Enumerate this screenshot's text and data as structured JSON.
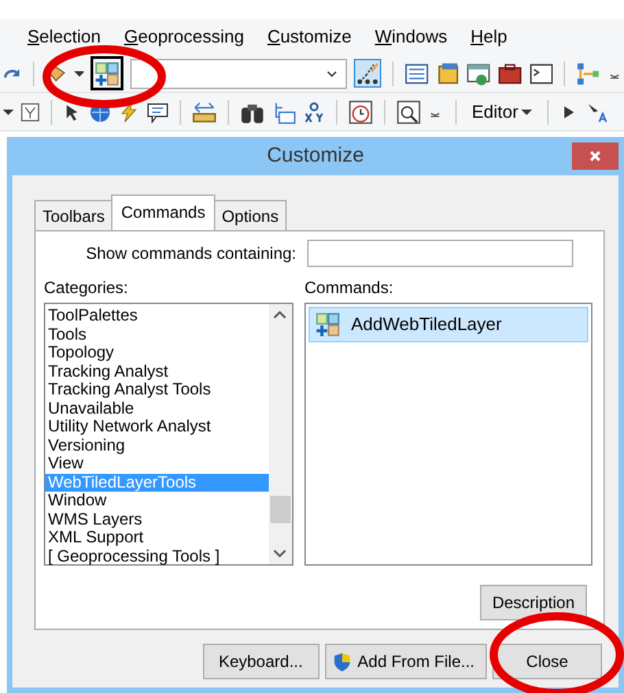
{
  "menu_bar": [
    {
      "label": "Selection"
    },
    {
      "label": "Geoprocessing"
    },
    {
      "label": "Customize"
    },
    {
      "label": "Windows"
    },
    {
      "label": "Help"
    }
  ],
  "toolbar": {
    "editor_menu": "Editor"
  },
  "dialog": {
    "title": "Customize",
    "tabs": [
      {
        "label": "Toolbars",
        "selected": false
      },
      {
        "label": "Commands",
        "selected": true
      },
      {
        "label": "Options",
        "selected": false
      }
    ],
    "search_label": "Show commands containing:",
    "categories_label": "Categories:",
    "categories": [
      {
        "label": "ToolPalettes",
        "selected": false
      },
      {
        "label": "Tools",
        "selected": false
      },
      {
        "label": "Topology",
        "selected": false
      },
      {
        "label": "Tracking Analyst",
        "selected": false
      },
      {
        "label": "Tracking Analyst Tools",
        "selected": false
      },
      {
        "label": "Unavailable",
        "selected": false
      },
      {
        "label": "Utility Network Analyst",
        "selected": false
      },
      {
        "label": "Versioning",
        "selected": false
      },
      {
        "label": "View",
        "selected": false
      },
      {
        "label": "WebTiledLayerTools",
        "selected": true
      },
      {
        "label": "Window",
        "selected": false
      },
      {
        "label": "WMS Layers",
        "selected": false
      },
      {
        "label": "XML Support",
        "selected": false
      },
      {
        "label": "[ Geoprocessing Tools ]",
        "selected": false
      }
    ],
    "commands_label": "Commands:",
    "commands": [
      {
        "label": "AddWebTiledLayer",
        "selected": true
      }
    ],
    "description_button": "Description",
    "buttons": [
      "Keyboard...",
      "Add From File...",
      "Close"
    ]
  }
}
